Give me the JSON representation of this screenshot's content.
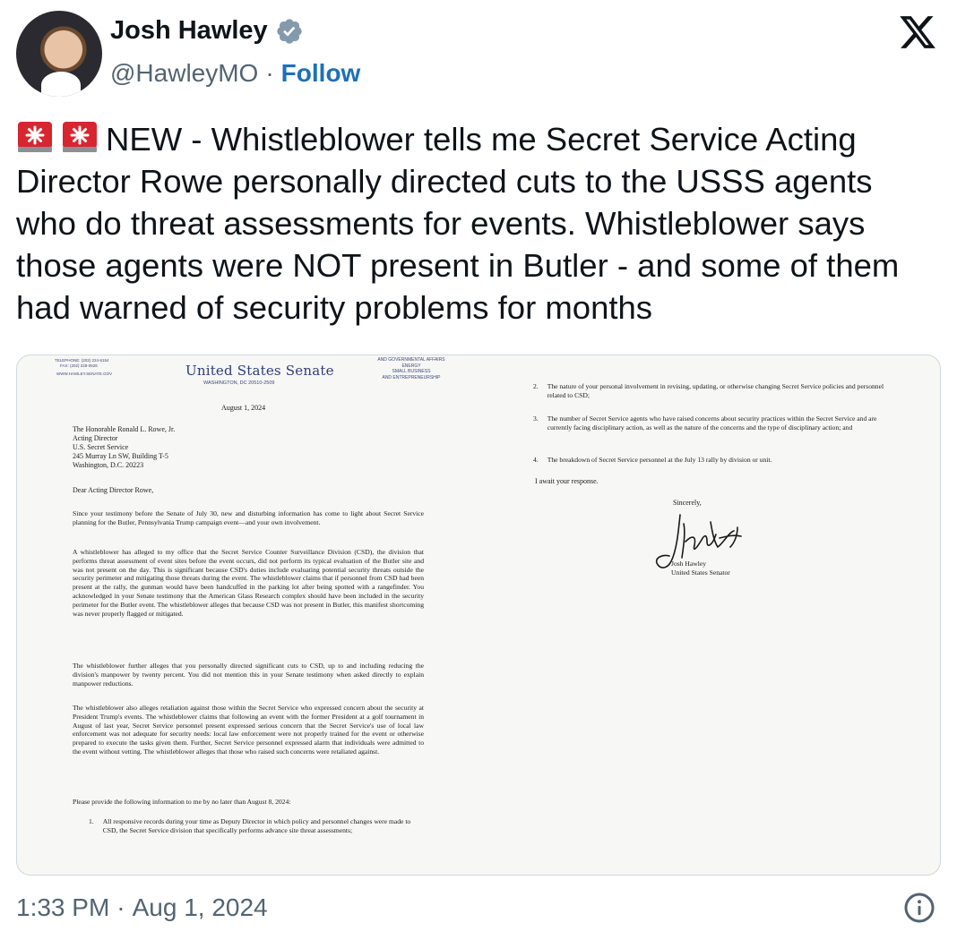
{
  "author": {
    "name": "Josh Hawley",
    "handle": "@HawleyMO",
    "separator": "·",
    "follow_label": "Follow"
  },
  "icons": {
    "verified": "verified-badge-icon",
    "platform": "x-logo-icon",
    "emoji": "rotating-light-emoji",
    "info": "info-icon"
  },
  "colors": {
    "link_blue": "#1d70b8",
    "verified_gray": "#829aab",
    "siren_red": "#d7262f"
  },
  "tweet": {
    "text": "NEW - Whistleblower tells me Secret Service Acting Director Rowe personally directed cuts to the USSS agents who do threat assessments for events. Whistleblower says those agents were NOT present in Butler - and some of them had warned of security problems for months"
  },
  "letter": {
    "letterhead": {
      "contact": [
        "TELEPHONE: (202) 224-6154",
        "FAX: (202) 228-0526",
        "WWW.HAWLEY.SENATE.GOV"
      ],
      "title": "United States Senate",
      "address": "WASHINGTON, DC 20510-2509",
      "committees": [
        "AND GOVERNMENTAL AFFAIRS",
        "ENERGY",
        "SMALL BUSINESS",
        "AND ENTREPRENEURSHIP"
      ]
    },
    "date": "August 1, 2024",
    "recipient": [
      "The Honorable Ronald L. Rowe, Jr.",
      "Acting Director",
      "U.S. Secret Service",
      "245 Murray Ln SW, Building T-5",
      "Washington, D.C. 20223"
    ],
    "salutation": "Dear Acting Director Rowe,",
    "paragraphs": [
      "Since your testimony before the Senate of July 30, new and disturbing information has come to light about Secret Service planning for the Butler, Pennsylvania Trump campaign event—and your own involvement.",
      "A whistleblower has alleged to my office that the Secret Service Counter Surveillance Division (CSD), the division that performs threat assessment of event sites before the event occurs, did not perform its typical evaluation of the Butler site and was not present on the day. This is significant because CSD's duties include evaluating potential security threats outside the security perimeter and mitigating those threats during the event. The whistleblower claims that if personnel from CSD had been present at the rally, the gunman would have been handcuffed in the parking lot after being spotted with a rangefinder. You acknowledged in your Senate testimony that the American Glass Research complex should have been included in the security perimeter for the Butler event. The whistleblower alleges that because CSD was not present in Butler, this manifest shortcoming was never properly flagged or mitigated.",
      "The whistleblower further alleges that you personally directed significant cuts to CSD, up to and including reducing the division's manpower by twenty percent. You did not mention this in your Senate testimony when asked directly to explain manpower reductions.",
      "The whistleblower also alleges retaliation against those within the Secret Service who expressed concern about the security at President Trump's events. The whistleblower claims that following an event with the former President at a golf tournament in August of last year, Secret Service personnel present expressed serious concern that the Secret Service's use of local law enforcement was not adequate for security needs: local law enforcement were not properly trained for the event or otherwise prepared to execute the tasks given them. Further, Secret Service personnel expressed alarm that individuals were admitted to the event without vetting. The whistleblower alleges that those who raised such concerns were retaliated against.",
      "Please provide the following information to me by no later than August 8, 2024:"
    ],
    "items": [
      {
        "num": "1.",
        "text": "All responsive records during your time as Deputy Director in which policy and personnel changes were made to CSD, the Secret Service division that specifically performs advance site threat assessments;"
      },
      {
        "num": "2.",
        "text": "The nature of your personal involvement in revising, updating, or otherwise changing Secret Service policies and personnel related to CSD;"
      },
      {
        "num": "3.",
        "text": "The number of Secret Service agents who have raised concerns about security practices within the Secret Service and are currently facing disciplinary action, as well as the nature of the concerns and the type of disciplinary action; and"
      },
      {
        "num": "4.",
        "text": "The breakdown of Secret Service personnel at the July 13 rally by division or unit."
      }
    ],
    "closing": "I await your response.",
    "sincerely": "Sincerely,",
    "signer_name": "Josh Hawley",
    "signer_title": "United States Senator"
  },
  "footer": {
    "time": "1:33 PM",
    "separator": "·",
    "date": "Aug 1, 2024"
  }
}
